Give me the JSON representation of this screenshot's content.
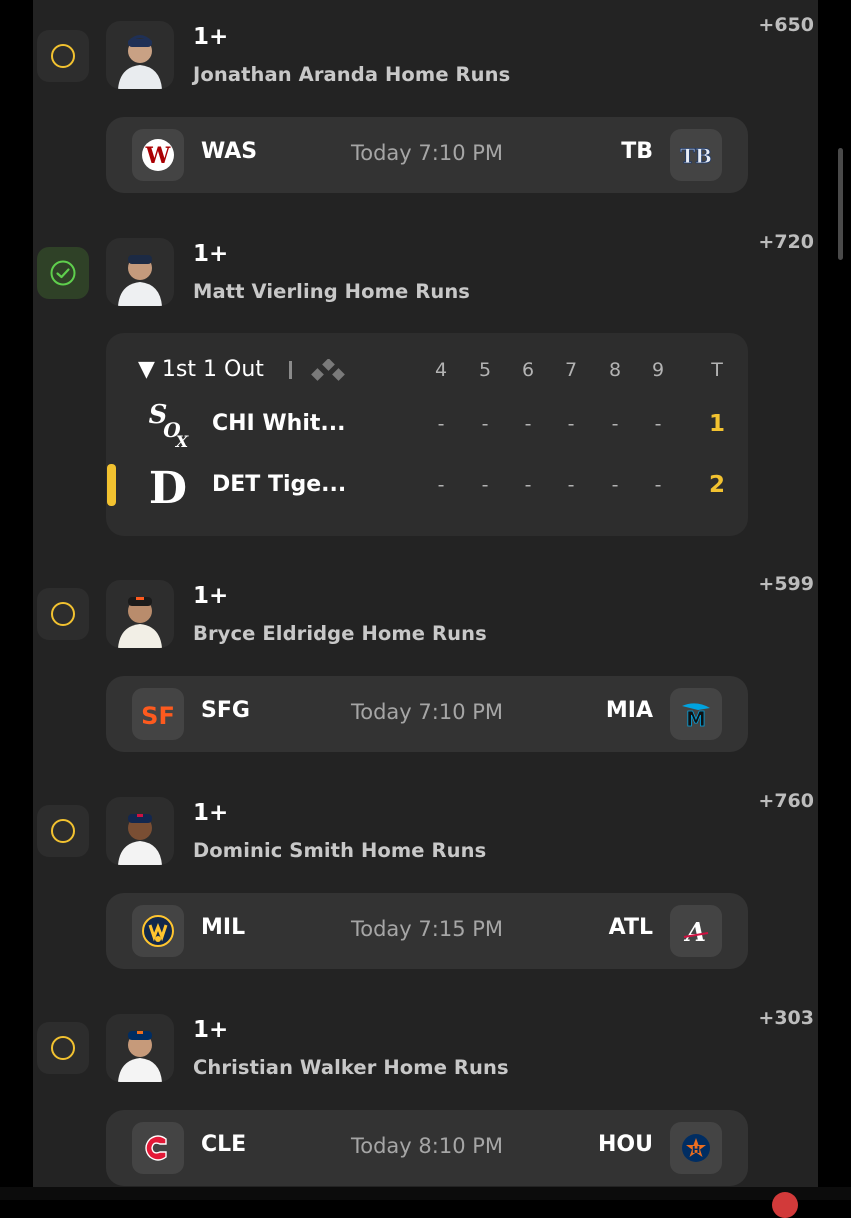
{
  "colors": {
    "accent": "#f2c230",
    "won": "#5fcf4d",
    "card": "#333333",
    "panel": "#232323"
  },
  "legs": [
    {
      "status": "pending",
      "line": "1+",
      "market": "Jonathan Aranda Home Runs",
      "odds": "+650",
      "avatar_icon": "player-headshot-icon",
      "game": {
        "away": "WAS",
        "home": "TB",
        "time": "Today 7:10 PM",
        "away_icon": "nationals-logo-icon",
        "home_icon": "rays-logo-icon"
      }
    },
    {
      "status": "won",
      "line": "1+",
      "market": "Matt Vierling Home Runs",
      "odds": "+720",
      "avatar_icon": "player-headshot-icon",
      "live": {
        "inning": "1st",
        "outs": "1 Out",
        "columns": [
          "4",
          "5",
          "6",
          "7",
          "8",
          "9"
        ],
        "total_label": "T",
        "teams": [
          {
            "name": "CHI Whit...",
            "icon": "white-sox-logo-icon",
            "innings": [
              "-",
              "-",
              "-",
              "-",
              "-",
              "-"
            ],
            "total": "1"
          },
          {
            "name": "DET Tige...",
            "icon": "tigers-logo-icon",
            "innings": [
              "-",
              "-",
              "-",
              "-",
              "-",
              "-"
            ],
            "total": "2",
            "batting": true
          }
        ]
      }
    },
    {
      "status": "pending",
      "line": "1+",
      "market": "Bryce Eldridge Home Runs",
      "odds": "+599",
      "avatar_icon": "player-headshot-icon",
      "game": {
        "away": "SFG",
        "home": "MIA",
        "time": "Today 7:10 PM",
        "away_icon": "giants-logo-icon",
        "home_icon": "marlins-logo-icon"
      }
    },
    {
      "status": "pending",
      "line": "1+",
      "market": "Dominic Smith Home Runs",
      "odds": "+760",
      "avatar_icon": "player-headshot-icon",
      "game": {
        "away": "MIL",
        "home": "ATL",
        "time": "Today 7:15 PM",
        "away_icon": "brewers-logo-icon",
        "home_icon": "braves-logo-icon"
      }
    },
    {
      "status": "pending",
      "line": "1+",
      "market": "Christian Walker Home Runs",
      "odds": "+303",
      "avatar_icon": "player-headshot-icon",
      "game": {
        "away": "CLE",
        "home": "HOU",
        "time": "Today 8:10 PM",
        "away_icon": "guardians-logo-icon",
        "home_icon": "astros-logo-icon"
      }
    }
  ]
}
